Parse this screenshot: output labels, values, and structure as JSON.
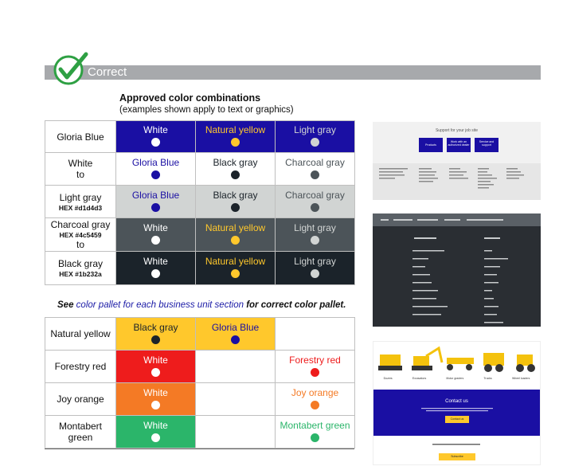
{
  "banner": {
    "label": "Correct"
  },
  "heading": {
    "title": "Approved color combinations",
    "subtitle": "(examples shown apply to text or graphics)"
  },
  "table1": {
    "header": [
      {
        "text": "White",
        "bg": "#1a0fa3",
        "fg": "#ffffff",
        "dot": "#ffffff"
      },
      {
        "text": "Natural yellow",
        "bg": "#1a0fa3",
        "fg": "#ffc82c",
        "dot": "#ffc82c"
      },
      {
        "text": "Light gray",
        "bg": "#1a0fa3",
        "fg": "#d1d4d3",
        "dot": "#d1d4d3"
      }
    ],
    "rows": [
      {
        "label": "Gloria Blue",
        "hex": "",
        "to": "",
        "cells": []
      },
      {
        "label": "White",
        "hex": "",
        "to": "to",
        "cells": [
          {
            "text": "Gloria Blue",
            "bg": "#ffffff",
            "fg": "#1a0fa3",
            "dot": "#1a0fa3"
          },
          {
            "text": "Black gray",
            "bg": "#ffffff",
            "fg": "#1b232a",
            "dot": "#1b232a"
          },
          {
            "text": "Charcoal gray",
            "bg": "#ffffff",
            "fg": "#4c5459",
            "dot": "#4c5459"
          }
        ]
      },
      {
        "label": "Light gray",
        "hex": "HEX #d1d4d3",
        "to": "",
        "cells": [
          {
            "text": "Gloria Blue",
            "bg": "#d1d4d3",
            "fg": "#1a0fa3",
            "dot": "#1a0fa3"
          },
          {
            "text": "Black gray",
            "bg": "#d1d4d3",
            "fg": "#1b232a",
            "dot": "#1b232a"
          },
          {
            "text": "Charcoal gray",
            "bg": "#d1d4d3",
            "fg": "#4c5459",
            "dot": "#4c5459"
          }
        ]
      },
      {
        "label": "Charcoal gray",
        "hex": "HEX #4c5459",
        "to": "to",
        "cells": [
          {
            "text": "White",
            "bg": "#4c5459",
            "fg": "#ffffff",
            "dot": "#ffffff"
          },
          {
            "text": "Natural yellow",
            "bg": "#4c5459",
            "fg": "#ffc82c",
            "dot": "#ffc82c"
          },
          {
            "text": "Light gray",
            "bg": "#4c5459",
            "fg": "#d1d4d3",
            "dot": "#d1d4d3"
          }
        ]
      },
      {
        "label": "Black gray",
        "hex": "HEX #1b232a",
        "to": "",
        "cells": [
          {
            "text": "White",
            "bg": "#1b232a",
            "fg": "#ffffff",
            "dot": "#ffffff"
          },
          {
            "text": "Natural yellow",
            "bg": "#1b232a",
            "fg": "#ffc82c",
            "dot": "#ffc82c"
          },
          {
            "text": "Light gray",
            "bg": "#1b232a",
            "fg": "#d1d4d3",
            "dot": "#d1d4d3"
          }
        ]
      }
    ]
  },
  "note": {
    "pre": "See ",
    "link": "color pallet for each business unit section",
    "post": " for correct color pallet."
  },
  "table2": {
    "rows": [
      {
        "label": "Natural yellow",
        "cells": [
          {
            "text": "Black gray",
            "bg": "#ffc82c",
            "fg": "#1b232a",
            "dot": "#1b232a"
          },
          {
            "text": "Gloria Blue",
            "bg": "#ffc82c",
            "fg": "#1a0fa3",
            "dot": "#1a0fa3"
          },
          {
            "text": "",
            "bg": "#ffffff",
            "fg": "#000000",
            "dot": ""
          }
        ]
      },
      {
        "label": "Forestry red",
        "cells": [
          {
            "text": "White",
            "bg": "#ee1c1c",
            "fg": "#ffffff",
            "dot": "#ffffff"
          },
          {
            "text": "",
            "bg": "#ffffff",
            "fg": "#000000",
            "dot": ""
          },
          {
            "text": "Forestry red",
            "bg": "#ffffff",
            "fg": "#ee1c1c",
            "dot": "#ee1c1c"
          }
        ]
      },
      {
        "label": "Joy orange",
        "cells": [
          {
            "text": "White",
            "bg": "#f47a25",
            "fg": "#ffffff",
            "dot": "#ffffff"
          },
          {
            "text": "",
            "bg": "#ffffff",
            "fg": "#000000",
            "dot": ""
          },
          {
            "text": "Joy orange",
            "bg": "#ffffff",
            "fg": "#f47a25",
            "dot": "#f47a25"
          }
        ]
      },
      {
        "label": "Montabert green",
        "cells": [
          {
            "text": "White",
            "bg": "#2bb56a",
            "fg": "#ffffff",
            "dot": "#ffffff"
          },
          {
            "text": "",
            "bg": "#ffffff",
            "fg": "#000000",
            "dot": ""
          },
          {
            "text": "Montabert green",
            "bg": "#ffffff",
            "fg": "#2bb56a",
            "dot": "#2bb56a"
          }
        ]
      }
    ]
  },
  "thumbnails": {
    "support": {
      "heading": "Support for your job site",
      "buttons": [
        "Products",
        "Work with an authorized dealer",
        "Service and support"
      ]
    },
    "contact": {
      "heading": "Contact us",
      "button": "Contact us",
      "subscribe_button": "Subscribe",
      "machines": [
        "Dozers",
        "Excavators",
        "Motor graders",
        "Trucks",
        "Wheel loaders"
      ]
    }
  },
  "colors": {
    "banner_gray": "#a7a9ac",
    "check_green": "#2ea043",
    "gloria_blue": "#1a0fa3"
  }
}
